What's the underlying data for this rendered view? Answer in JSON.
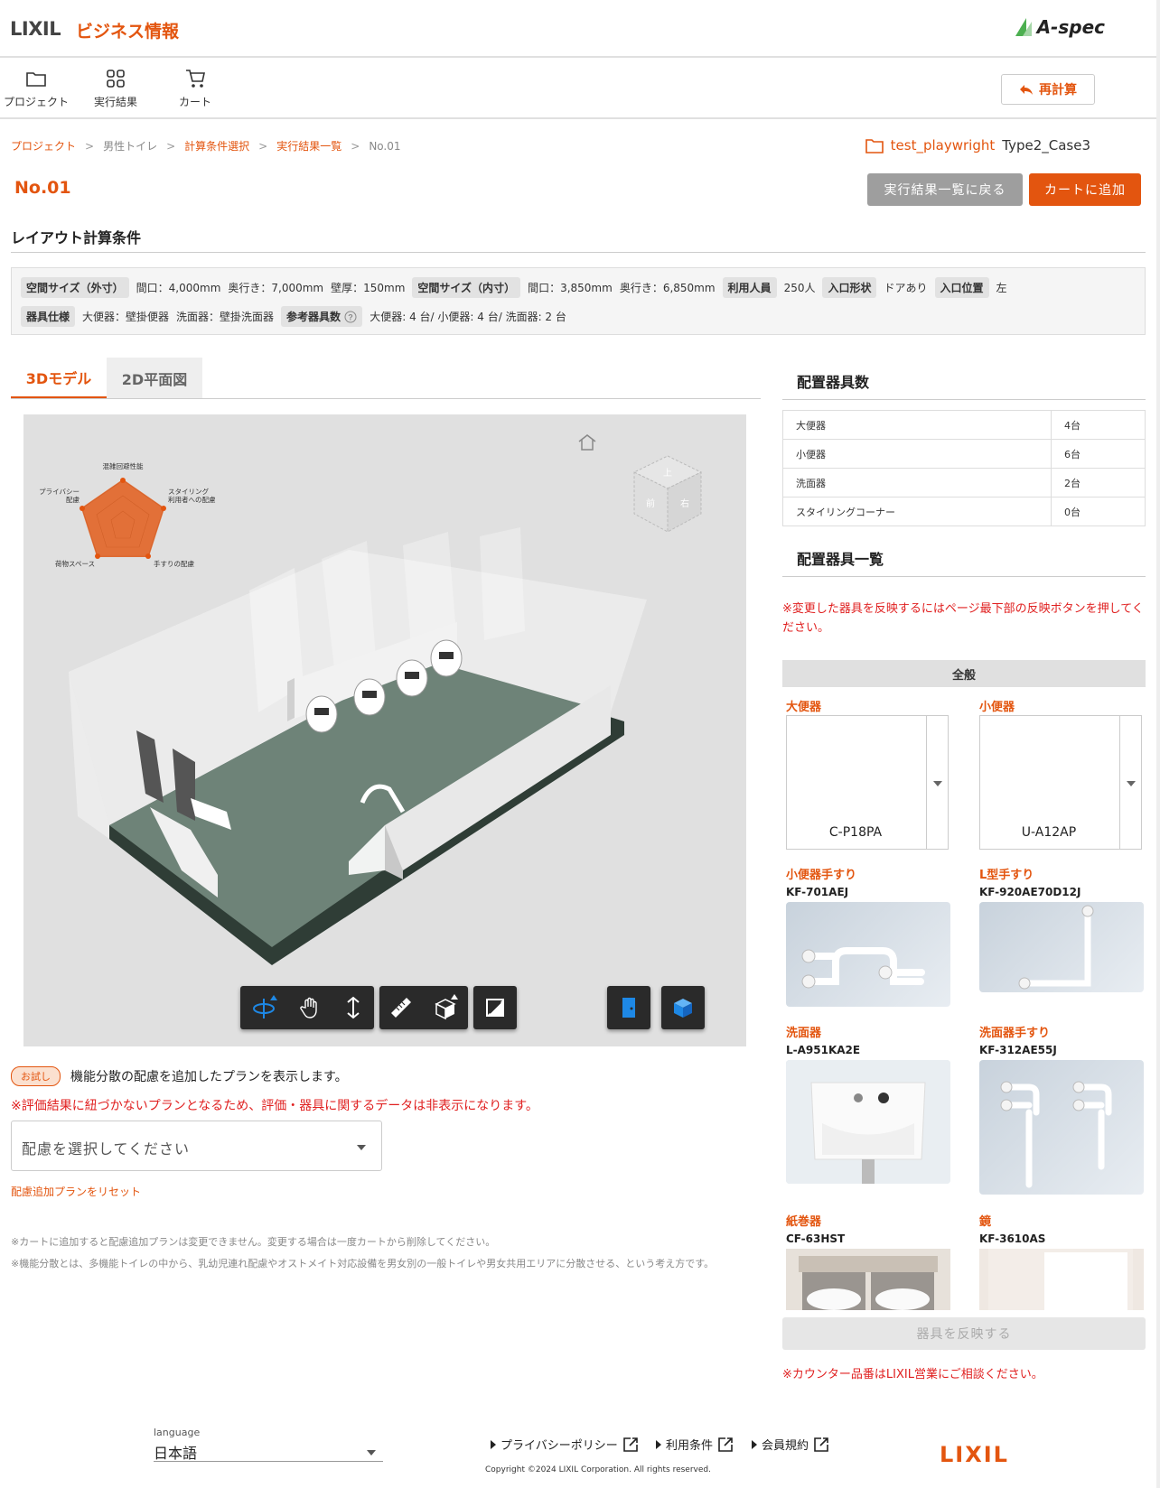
{
  "header": {
    "brand_lixil": "LIXIL",
    "brand_biz": "ビジネス情報",
    "aspec": "A-spec"
  },
  "nav": {
    "project": "プロジェクト",
    "results": "実行結果",
    "cart": "カート",
    "recalc": "再計算"
  },
  "breadcrumb": {
    "b1": "プロジェクト",
    "b2": "男性トイレ",
    "b3": "計算条件選択",
    "b4": "実行結果一覧",
    "b5": "No.01",
    "sep": ">"
  },
  "project_info": {
    "name": "test_playwright",
    "case": "Type2_Case3"
  },
  "page": {
    "title": "No.01",
    "back_button": "実行結果一覧に戻る",
    "cart_button": "カートに追加"
  },
  "conditions": {
    "title": "レイアウト計算条件",
    "outer_label": "空間サイズ（外寸）",
    "outer_width": "間口：4,000mm",
    "outer_depth": "奥行き：7,000mm",
    "wall": "壁厚：150mm",
    "inner_label": "空間サイズ（内寸）",
    "inner_width": "間口：3,850mm",
    "inner_depth": "奥行き：6,850mm",
    "users_label": "利用人員",
    "users": "250人",
    "entry_label": "入口形状",
    "entry": "ドアあり",
    "pos_label": "入口位置",
    "pos": "左",
    "spec_label": "器具仕様",
    "spec_wc": "大便器：壁掛便器",
    "spec_basin": "洗面器：壁掛洗面器",
    "ref_label": "参考器具数",
    "ref_value": "大便器: 4 台/ 小便器: 4 台/ 洗面器: 2 台"
  },
  "tabs": {
    "tab3d": "3Dモデル",
    "tab2d": "2D平面図"
  },
  "radar": {
    "top": "混雑回避性能",
    "right1": "スタイリング",
    "right2": "利用者への配慮",
    "bright": "手すりの配慮",
    "bleft": "荷物スペース",
    "left1": "プライバシー",
    "left2": "配慮"
  },
  "cube": {
    "top": "上",
    "front": "前",
    "right": "右"
  },
  "trial": {
    "chip": "お試し",
    "text": "機能分散の配慮を追加したプランを表示します。",
    "warning": "※評価結果に紐づかないプランとなるため、評価・器具に関するデータは非表示になります。",
    "select_placeholder": "配慮を選択してください",
    "reset": "配慮追加プランをリセット",
    "note1": "※カートに追加すると配慮追加プランは変更できません。変更する場合は一度カートから削除してください。",
    "note2": "※機能分散とは、多機能トイレの中から、乳幼児連れ配慮やオストメイト対応設備を男女別の一般トイレや男女共用エリアに分散させる、という考え方です。"
  },
  "counts": {
    "title": "配置器具数",
    "rows": [
      {
        "name": "大便器",
        "value": "4台"
      },
      {
        "name": "小便器",
        "value": "6台"
      },
      {
        "name": "洗面器",
        "value": "2台"
      },
      {
        "name": "スタイリングコーナー",
        "value": "0台"
      }
    ]
  },
  "fixtures": {
    "title": "配置器具一覧",
    "warning": "※変更した器具を反映するにはページ最下部の反映ボタンを押してください。",
    "general": "全般",
    "wc_label": "大便器",
    "wc_code": "C-P18PA",
    "urinal_label": "小便器",
    "urinal_code": "U-A12AP",
    "urinal_rail_label": "小便器手すり",
    "urinal_rail_model": "KF-701AEJ",
    "l_rail_label": "L型手すり",
    "l_rail_model": "KF-920AE70D12J",
    "basin_label": "洗面器",
    "basin_model": "L-A951KA2E",
    "basin_rail_label": "洗面器手すり",
    "basin_rail_model": "KF-312AE55J",
    "paper_label": "紙巻器",
    "paper_model": "CF-63HST",
    "mirror_label": "鏡",
    "mirror_model": "KF-3610AS",
    "reflect_button": "器具を反映する",
    "counter_note": "※カウンター品番はLIXIL営業にご相談ください。"
  },
  "footer": {
    "lang_label": "language",
    "lang_value": "日本語",
    "privacy": "プライバシーポリシー",
    "terms": "利用条件",
    "member": "会員規約",
    "copyright": "Copyright ©2024 LIXIL Corporation. All rights reserved.",
    "logo": "LIXIL"
  },
  "colors": {
    "accent": "#e3550f",
    "warning": "#e02020",
    "toolbar": "#2a2a2a",
    "tool_blue": "#1e88e5"
  }
}
